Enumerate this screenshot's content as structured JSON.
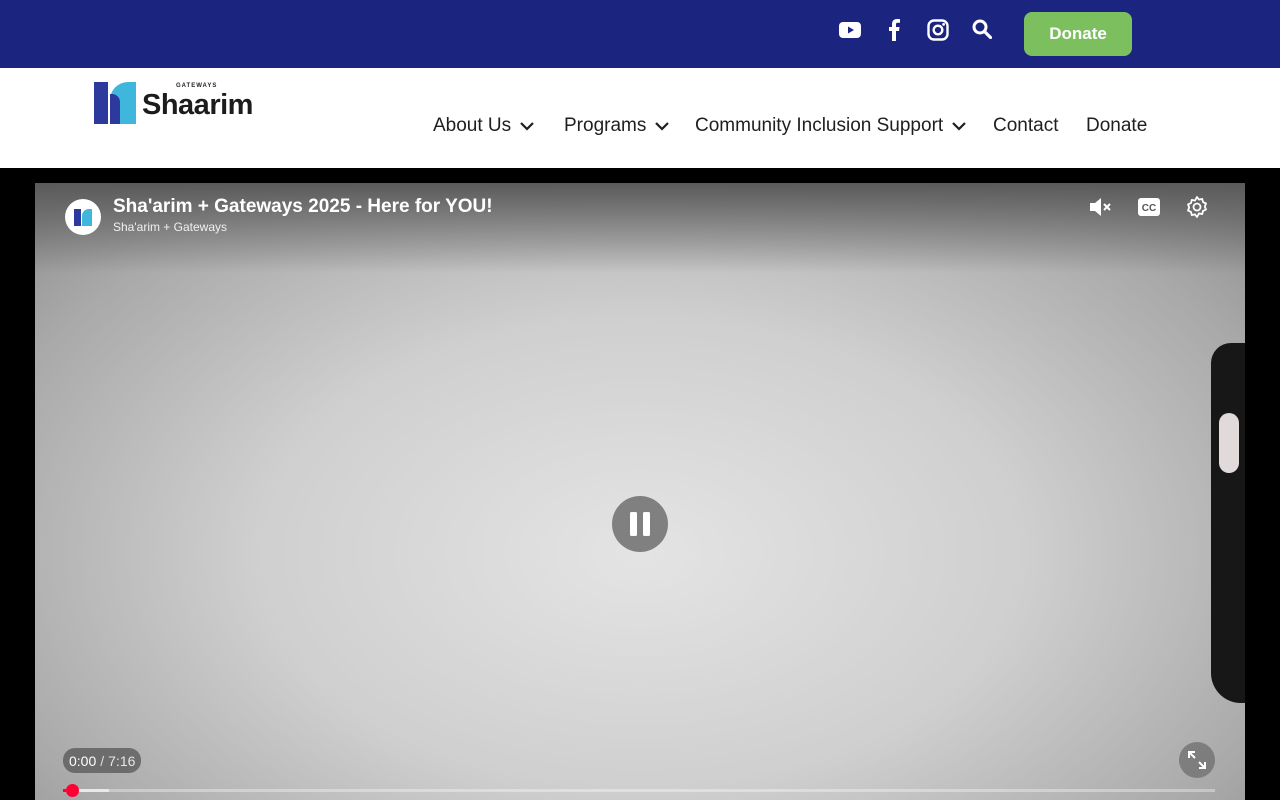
{
  "topbar": {
    "icons": [
      "youtube-icon",
      "facebook-icon",
      "instagram-icon",
      "search-icon"
    ],
    "donate_label": "Donate",
    "background": "#1b2580",
    "donate_color": "#7cbf5f"
  },
  "header": {
    "logo": {
      "tagline": "GATEWAYS",
      "wordmark": "Shaarim"
    },
    "nav": [
      {
        "label": "About Us",
        "has_dropdown": true
      },
      {
        "label": "Programs",
        "has_dropdown": true
      },
      {
        "label": "Community Inclusion Support",
        "has_dropdown": true
      },
      {
        "label": "Contact",
        "has_dropdown": false
      },
      {
        "label": "Donate",
        "has_dropdown": false
      }
    ]
  },
  "video": {
    "title": "Sha'arim + Gateways 2025 - Here for YOU!",
    "channel": "Sha'arim + Gateways",
    "current_time": "0:00",
    "separator": "/",
    "duration": "7:16",
    "progress_fraction": 0.003,
    "buffered_fraction": 0.04,
    "controls": [
      "muted-speaker-icon",
      "closed-captions-icon",
      "settings-gear-icon",
      "pause-icon",
      "fullscreen-icon"
    ],
    "progress_color": "#ff0033"
  }
}
